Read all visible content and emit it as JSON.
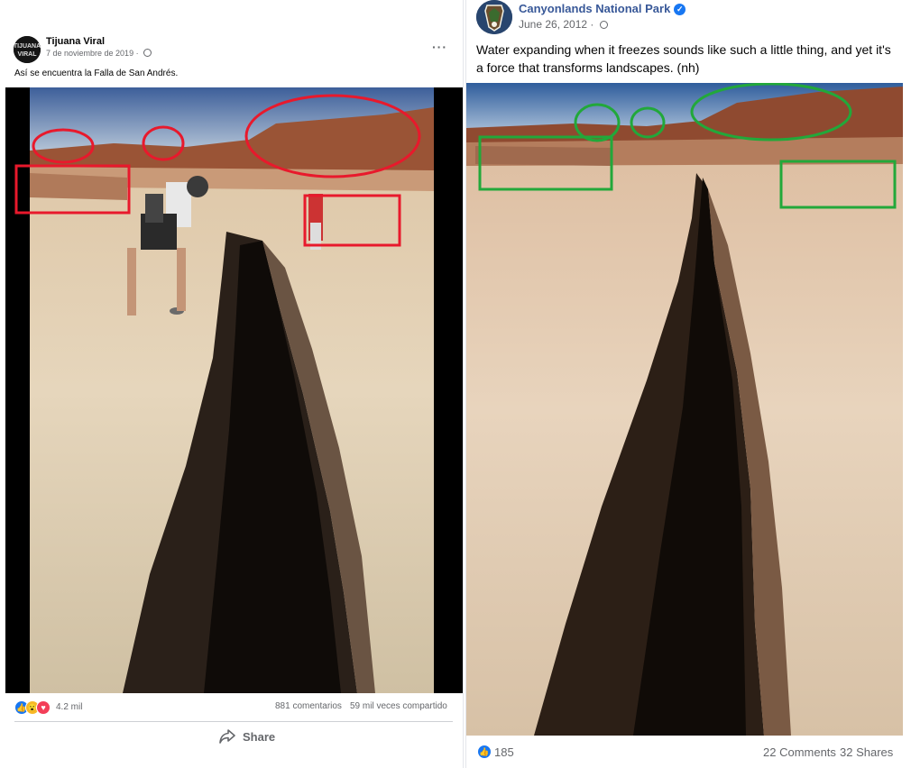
{
  "left_post": {
    "author": "Tijuana Viral",
    "date": "7 de noviembre de 2019 · ",
    "menu": "···",
    "caption": "Así se encuentra la Falla de San Andrés.",
    "reaction_count": "4.2 mil",
    "comments": "881 comentarios",
    "shares": "59 mil veces compartido",
    "share_label": "Share",
    "annotation_color": "#e8192c"
  },
  "right_post": {
    "author": "Canyonlands National Park",
    "verified_mark": "✓",
    "date": "June 26, 2012 · ",
    "caption": "Water expanding when it freezes sounds like such a little thing, and yet it's a force that transforms landscapes. (nh)",
    "reaction_count": "185",
    "comments": "22 Comments",
    "shares": "32 Shares",
    "annotation_color": "#22a83a"
  },
  "colors": {
    "like_blue": "#1877f2",
    "love_red": "#f33e58",
    "wow_yellow": "#f7b928",
    "meta_gray": "#65676b"
  },
  "icons": [
    "globe-icon",
    "like-icon",
    "wow-icon",
    "love-icon",
    "share-arrow-icon",
    "verified-icon",
    "more-icon"
  ]
}
